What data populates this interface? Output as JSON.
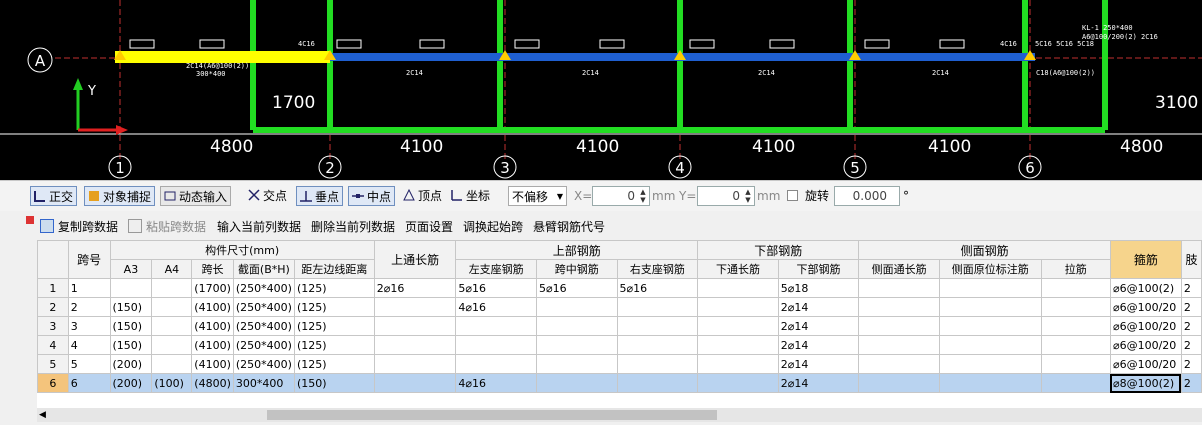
{
  "cad": {
    "axis_row": "A",
    "axis_y_label": "Y",
    "col_labels": [
      "1",
      "2",
      "3",
      "4",
      "5",
      "6"
    ],
    "dims": [
      "4800",
      "4100",
      "4100",
      "4100",
      "4100",
      "4800"
    ],
    "dim_left": "1700",
    "dim_right": "3100",
    "annot": {
      "a1": "4C16",
      "a2": "2C14(A6@100(2))",
      "a3": "300*400",
      "a4": "2C14",
      "a5": "2C14",
      "a6": "2C14",
      "a7": "2C14",
      "a8": "4C16",
      "a9": "5C16 5C16 5C18",
      "a10": "KL-1 250*400",
      "a11": "A6@100/200(2) 2C16",
      "a12": "C18(A6@100(2))"
    }
  },
  "snapbar": {
    "orth": "正交",
    "osnap": "对象捕捉",
    "dyn": "动态输入",
    "inter": "交点",
    "perp": "垂点",
    "mid": "中点",
    "vert": "顶点",
    "coord": "坐标",
    "offset": "不偏移",
    "x_label": "X=",
    "x_val": "0",
    "mm1": "mm",
    "y_label": "Y=",
    "y_val": "0",
    "mm2": "mm",
    "rotate": "旋转",
    "rot_val": "0.000",
    "deg": "°"
  },
  "toolbar": {
    "copy": "复制跨数据",
    "paste": "粘贴跨数据",
    "input_col": "输入当前列数据",
    "del_col": "删除当前列数据",
    "page_setup": "页面设置",
    "adjust": "调换起始跨",
    "cantilever": "悬臂钢筋代号"
  },
  "grid": {
    "h_span": "跨号",
    "h_size": "构件尺寸(mm)",
    "h_a3": "A3",
    "h_a4": "A4",
    "h_len": "跨长",
    "h_sec": "截面(B*H)",
    "h_dist": "距左边线距离",
    "h_top_long": "上通长筋",
    "h_top": "上部钢筋",
    "h_left": "左支座钢筋",
    "h_mid": "跨中钢筋",
    "h_right": "右支座钢筋",
    "h_bot": "下部钢筋",
    "h_bot_long": "下通长筋",
    "h_bot_bar": "下部钢筋",
    "h_side": "侧面钢筋",
    "h_side_long": "侧面通长筋",
    "h_side_orig": "侧面原位标注筋",
    "h_tie": "拉筋",
    "h_stirrup": "箍筋",
    "h_more": "肢",
    "rows": [
      {
        "n": "1",
        "span": "1",
        "a3": "",
        "a4": "",
        "len": "(1700)",
        "sec": "(250*400)",
        "dist": "(125)",
        "toplong": "2⌀16",
        "left": "5⌀16",
        "mid": "5⌀16",
        "right": "5⌀16",
        "botlong": "",
        "bot": "5⌀18",
        "sidelong": "",
        "sideorig": "",
        "tie": "",
        "stir": "⌀6@100(2)",
        "more": "2"
      },
      {
        "n": "2",
        "span": "2",
        "a3": "(150)",
        "a4": "",
        "len": "(4100)",
        "sec": "(250*400)",
        "dist": "(125)",
        "toplong": "",
        "left": "4⌀16",
        "mid": "",
        "right": "",
        "botlong": "",
        "bot": "2⌀14",
        "sidelong": "",
        "sideorig": "",
        "tie": "",
        "stir": "⌀6@100/20",
        "more": "2"
      },
      {
        "n": "3",
        "span": "3",
        "a3": "(150)",
        "a4": "",
        "len": "(4100)",
        "sec": "(250*400)",
        "dist": "(125)",
        "toplong": "",
        "left": "",
        "mid": "",
        "right": "",
        "botlong": "",
        "bot": "2⌀14",
        "sidelong": "",
        "sideorig": "",
        "tie": "",
        "stir": "⌀6@100/20",
        "more": "2"
      },
      {
        "n": "4",
        "span": "4",
        "a3": "(150)",
        "a4": "",
        "len": "(4100)",
        "sec": "(250*400)",
        "dist": "(125)",
        "toplong": "",
        "left": "",
        "mid": "",
        "right": "",
        "botlong": "",
        "bot": "2⌀14",
        "sidelong": "",
        "sideorig": "",
        "tie": "",
        "stir": "⌀6@100/20",
        "more": "2"
      },
      {
        "n": "5",
        "span": "5",
        "a3": "(200)",
        "a4": "",
        "len": "(4100)",
        "sec": "(250*400)",
        "dist": "(125)",
        "toplong": "",
        "left": "",
        "mid": "",
        "right": "",
        "botlong": "",
        "bot": "2⌀14",
        "sidelong": "",
        "sideorig": "",
        "tie": "",
        "stir": "⌀6@100/20",
        "more": "2"
      },
      {
        "n": "6",
        "span": "6",
        "a3": "(200)",
        "a4": "(100)",
        "len": "(4800)",
        "sec": "300*400",
        "dist": "(150)",
        "toplong": "",
        "left": "4⌀16",
        "mid": "",
        "right": "",
        "botlong": "",
        "bot": "2⌀14",
        "sidelong": "",
        "sideorig": "",
        "tie": "",
        "stir": "⌀8@100(2)",
        "more": "2"
      }
    ]
  },
  "colors": {
    "beam_current": "#ffff00",
    "beam": "#1f5fd0",
    "column": "#22dd22",
    "axis": "#ffffff",
    "selected_row": "#b9d3f0"
  }
}
